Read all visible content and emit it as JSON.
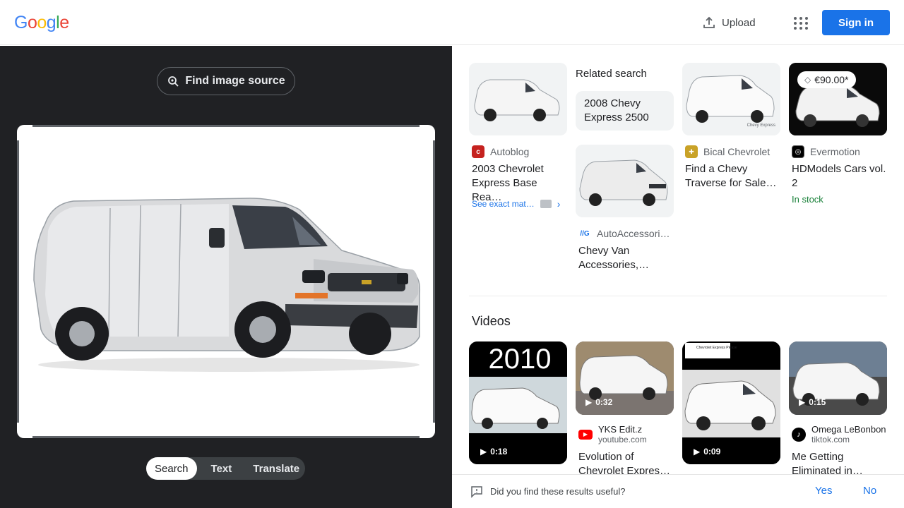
{
  "header": {
    "logo_letters": [
      "G",
      "o",
      "o",
      "g",
      "l",
      "e"
    ],
    "logo_colors": [
      "#4285F4",
      "#EA4335",
      "#FBBC05",
      "#4285F4",
      "#34A853",
      "#EA4335"
    ],
    "upload_label": "Upload",
    "signin_label": "Sign in"
  },
  "left_panel": {
    "find_source_label": "Find image source",
    "modes": [
      "Search",
      "Text",
      "Translate"
    ],
    "active_mode": "Search"
  },
  "results": {
    "related_search": {
      "label": "Related search",
      "query": "2008 Chevy Express 2500"
    },
    "items": [
      {
        "source": "Autoblog",
        "title": "2003 Chevrolet Express Base Rea…",
        "see_exact": "See exact mat…"
      },
      {
        "source": "AutoAccessori…",
        "title": "Chevy Van Accessories,…"
      },
      {
        "source": "Bical Chevrolet",
        "title": "Find a Chevy Traverse for Sale…",
        "thumb_caption": "Chevy Express"
      },
      {
        "source": "Evermotion",
        "title": "HDModels Cars vol. 2",
        "price": "€90.00*",
        "stock": "In stock"
      }
    ]
  },
  "videos": {
    "label": "Videos",
    "items": [
      {
        "overlay": "2010",
        "duration": "0:18"
      },
      {
        "duration": "0:32",
        "channel": "YKS Edit.z",
        "domain": "youtube.com",
        "title": "Evolution of Chevrolet Expres…"
      },
      {
        "duration": "0:09",
        "overlay_caption": "Chevrolet Express Please"
      },
      {
        "duration": "0:15",
        "channel": "Omega LeBonbon",
        "domain": "tiktok.com",
        "title": "Me Getting Eliminated in…"
      }
    ]
  },
  "feedback": {
    "question": "Did you find these results useful?",
    "yes": "Yes",
    "no": "No"
  }
}
